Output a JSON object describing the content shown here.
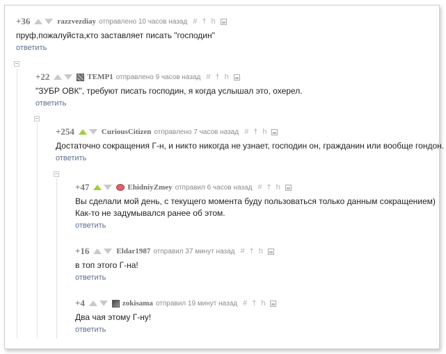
{
  "comments": [
    {
      "score": "+36",
      "username": "razzvezdiay",
      "meta": "отправлено 10 часов назад",
      "tools": [
        "#",
        "†",
        "h"
      ],
      "text": [
        "пруф,пожалуйста,кто заставляет писать \"господин\""
      ],
      "reply": "ответить",
      "avatar": "none",
      "upvoted": false
    },
    {
      "score": "+22",
      "username": "TEMP1",
      "meta": "отправлено 9 часов назад",
      "tools": [
        "#",
        "†",
        "h"
      ],
      "text": [
        "\"ЗУБР ОВК\", требуют писать господин, я когда услышал это, охерел."
      ],
      "reply": "ответить",
      "avatar": "pixel-avatar",
      "upvoted": false
    },
    {
      "score": "+254",
      "username": "CuriousCitizen",
      "meta": "отправлено 7 часов назад",
      "tools": [
        "#",
        "†",
        "h"
      ],
      "text": [
        "Достаточно сокращения Г-н, и никто никогда не узнает, господин он, гражданин или вообще гондон."
      ],
      "reply": "ответить",
      "avatar": "none",
      "upvoted": true
    },
    {
      "score": "+47",
      "username": "EhidniyZmey",
      "meta": "отправил 6 часов назад",
      "tools": [
        "#",
        "†",
        "h"
      ],
      "text": [
        "Вы сделали мой день, с текущего момента буду пользоваться только данным сокращением)",
        "Как-то не задумывался ранее об этом."
      ],
      "reply": "ответить",
      "avatar": "egg-avatar",
      "upvoted": true
    },
    {
      "score": "+16",
      "username": "Eldar1987",
      "meta": "отправил 37 минут назад",
      "tools": [
        "#",
        "†",
        "h"
      ],
      "text": [
        "в топ этого Г-на!"
      ],
      "reply": "ответить",
      "avatar": "none",
      "upvoted": false
    },
    {
      "score": "+4",
      "username": "zokisama",
      "meta": "отправил 19 минут назад",
      "tools": [
        "#",
        "†",
        "h"
      ],
      "text": [
        "Два чая этому Г-ну!"
      ],
      "reply": "ответить",
      "avatar": "gray-avatar",
      "upvoted": false
    }
  ],
  "colors": {
    "upvote_active": "#9ccf3a",
    "vote_inactive": "#c9c9c9",
    "reply_link": "#5a6f8f",
    "username": "#6c6c6c"
  }
}
